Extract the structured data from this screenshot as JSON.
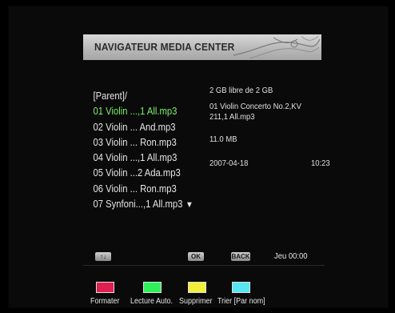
{
  "header": {
    "title": "NAVIGATEUR MEDIA CENTER"
  },
  "files": [
    {
      "label": "[Parent]/"
    },
    {
      "label": "01 Violin ...,1 All.mp3"
    },
    {
      "label": "02 Violin ... And.mp3"
    },
    {
      "label": "03 Violin ... Ron.mp3"
    },
    {
      "label": "04 Violin ...,1 All.mp3"
    },
    {
      "label": "05 Violin ...2 Ada.mp3"
    },
    {
      "label": "06 Violin ... Ron.mp3"
    },
    {
      "label": "07 Synfoni...,1 All.mp3"
    }
  ],
  "info": {
    "free_space": "2 GB libre de 2 GB",
    "name_line1": "01 Violin Concerto No.2,KV",
    "name_line2": "211,1 All.mp3",
    "size": "11.0 MB",
    "date": "2007-04-18",
    "time": "10:23"
  },
  "navbar": {
    "updown_label": "↑↓",
    "ok_label": "OK",
    "back_label": "BACK",
    "clock": "Jeu 00:00"
  },
  "colors": {
    "red": "#e01f4f",
    "green": "#2ef05a",
    "yellow": "#f2ef3a",
    "cyan": "#55e6f2",
    "selected_text": "#7cf06a"
  },
  "color_keys": {
    "red_label": "Formater",
    "green_label": "Lecture Auto.",
    "yellow_label": "Supprimer",
    "cyan_label": "Trier [Par nom]"
  }
}
